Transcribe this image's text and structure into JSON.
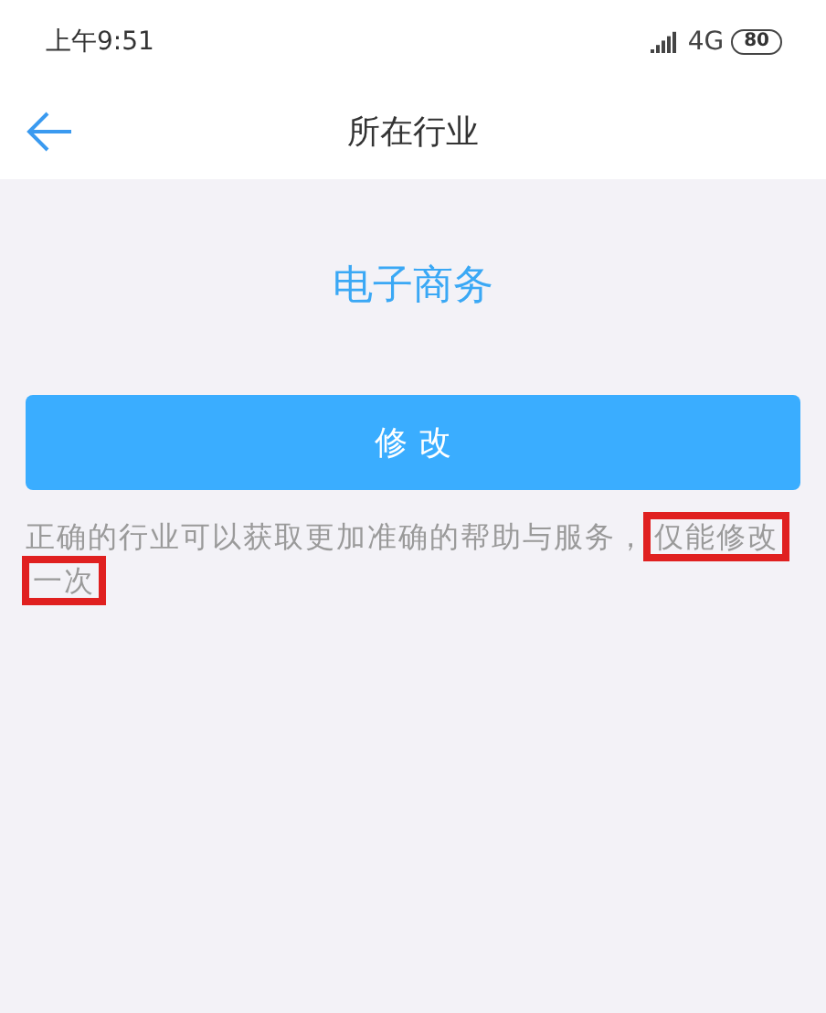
{
  "status_bar": {
    "time": "上午9:51",
    "network": "4G",
    "battery": "80"
  },
  "header": {
    "title": "所在行业"
  },
  "industry": "电子商务",
  "button": {
    "label": "修 改"
  },
  "notice": {
    "text": "正确的行业可以获取更加准确的帮助与服务，",
    "highlight": "仅能修改一次"
  }
}
